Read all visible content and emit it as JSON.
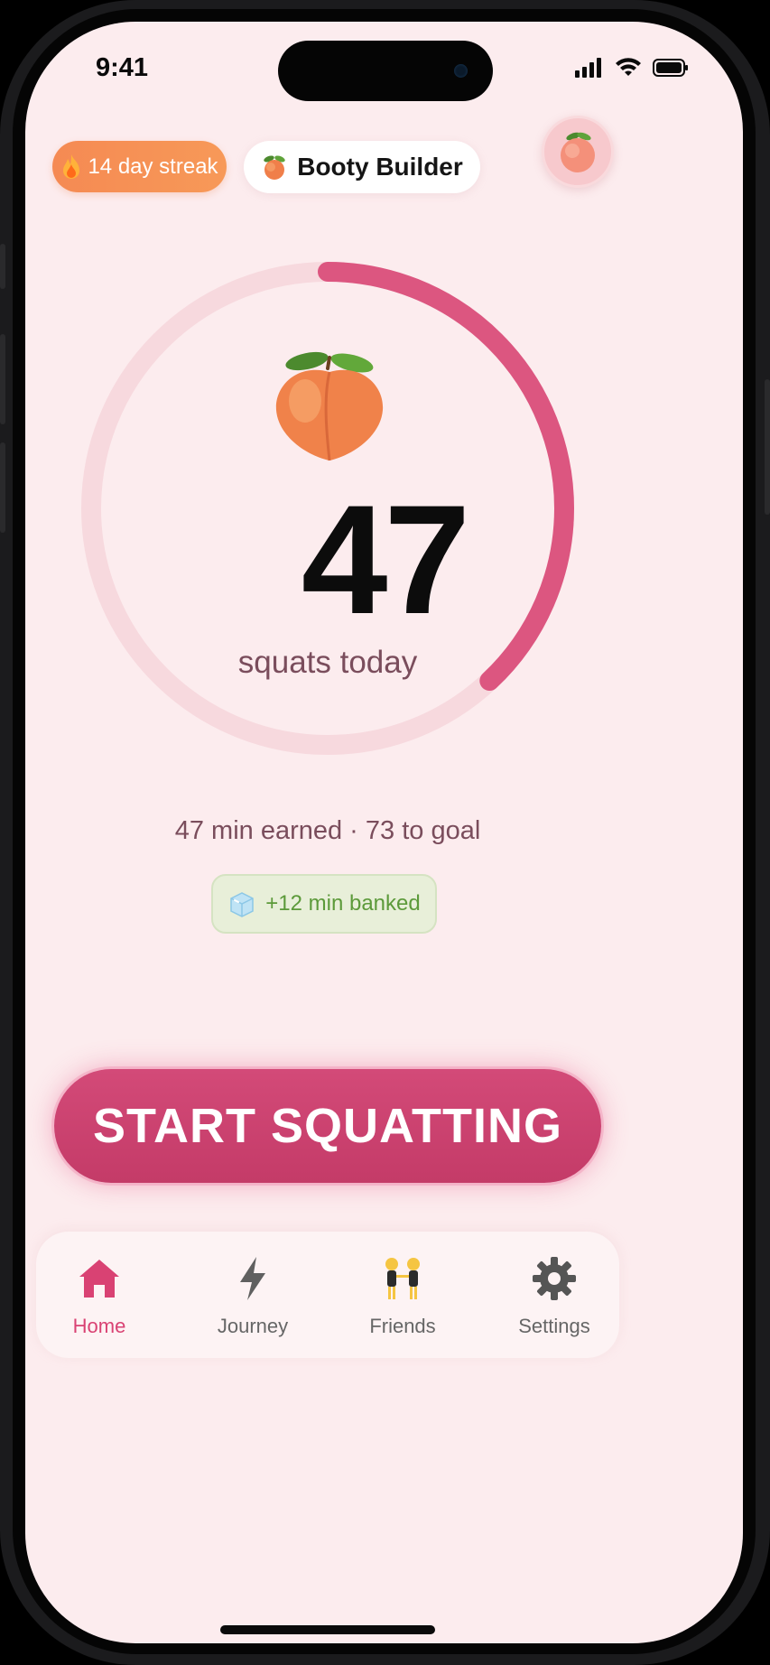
{
  "status_bar": {
    "time": "9:41"
  },
  "header": {
    "streak_label": "14 day streak",
    "title": "Booty Builder",
    "icons": [
      "fire-icon",
      "peach-icon",
      "avatar-peach-icon"
    ]
  },
  "progress": {
    "count": "47",
    "label": "squats today",
    "ring_fraction": 0.38,
    "earned_text": "47 min earned · 73 to goal",
    "banked_text": "+12 min banked",
    "banked_icon": "ice-cube-icon"
  },
  "cta": {
    "label": "START SQUATTING"
  },
  "tabs": [
    {
      "label": "Home",
      "icon": "home-icon",
      "active": true
    },
    {
      "label": "Journey",
      "icon": "lightning-icon",
      "active": false
    },
    {
      "label": "Friends",
      "icon": "two-women-icon",
      "active": false
    },
    {
      "label": "Settings",
      "icon": "gear-icon",
      "active": false
    }
  ],
  "colors": {
    "background": "#fcecee",
    "accent": "#d34a78",
    "ring_track": "#f7d9de",
    "streak": "#f58a53",
    "banked_text": "#5c9a3a"
  }
}
